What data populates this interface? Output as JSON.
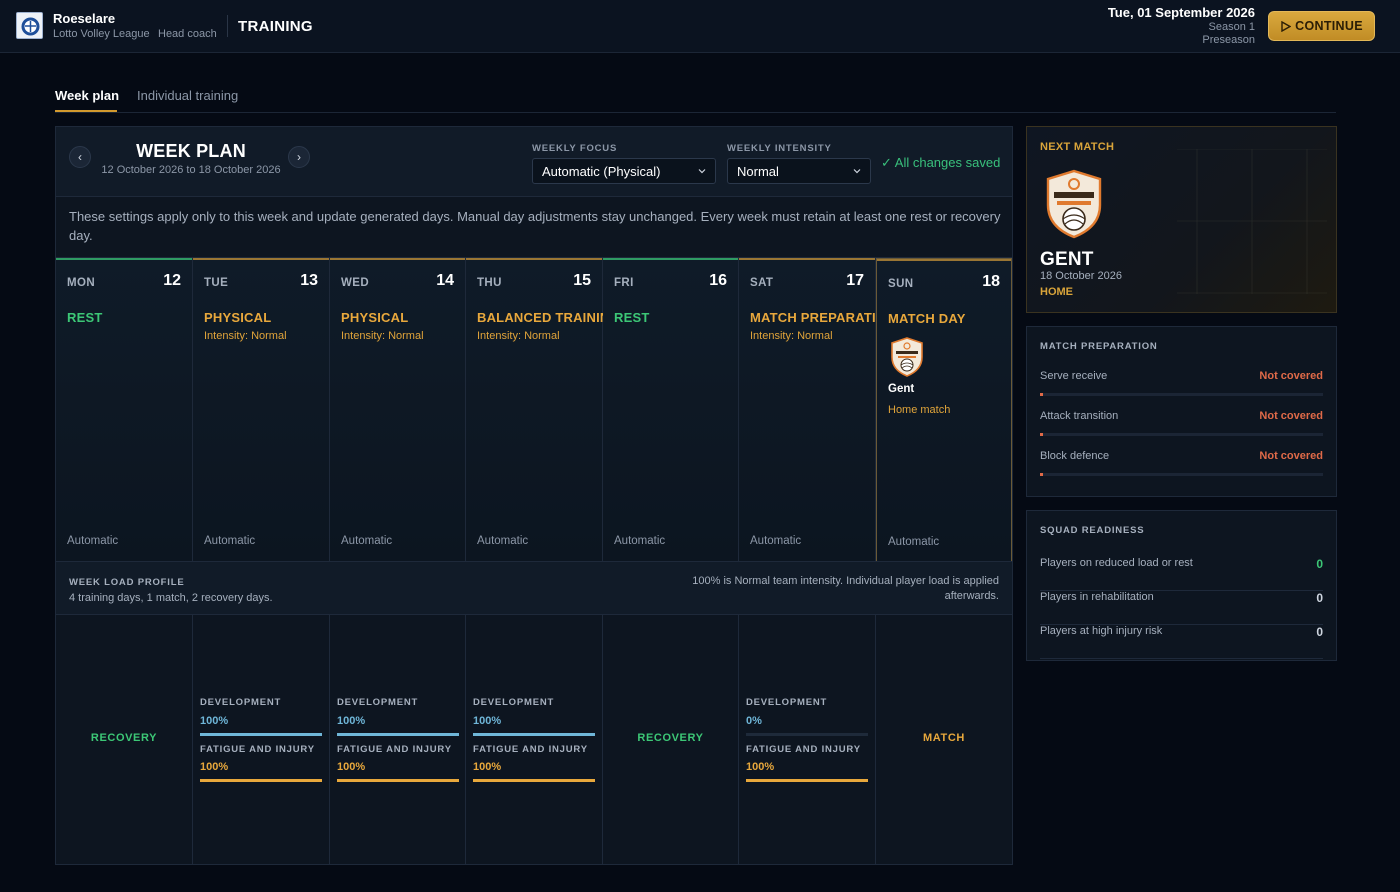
{
  "header": {
    "club_name": "Roeselare",
    "league": "Lotto Volley League",
    "role": "Head coach",
    "page_title": "TRAINING",
    "date": "Tue, 01 September 2026",
    "season": "Season 1",
    "phase": "Preseason",
    "continue_label": "CONTINUE"
  },
  "tabs": [
    {
      "label": "Week plan",
      "active": true
    },
    {
      "label": "Individual training",
      "active": false
    }
  ],
  "week_plan": {
    "title": "WEEK PLAN",
    "range": "12 October 2026 to 18 October 2026",
    "weekly_focus_label": "WEEKLY FOCUS",
    "weekly_focus_value": "Automatic (Physical)",
    "weekly_intensity_label": "WEEKLY INTENSITY",
    "weekly_intensity_value": "Normal",
    "saved_status": "✓ All changes saved",
    "info": "These settings apply only to this week and update generated days. Manual day adjustments stay unchanged. Every week must retain at least one rest or recovery day."
  },
  "days": [
    {
      "name": "MON",
      "num": "12",
      "type": "REST",
      "intensity": "",
      "mode": "Automatic",
      "color": "#3cc776",
      "top": "#2f9b63"
    },
    {
      "name": "TUE",
      "num": "13",
      "type": "PHYSICAL",
      "intensity": "Intensity: Normal",
      "mode": "Automatic",
      "color": "#e8a83c",
      "top": "#9a7634"
    },
    {
      "name": "WED",
      "num": "14",
      "type": "PHYSICAL",
      "intensity": "Intensity: Normal",
      "mode": "Automatic",
      "color": "#e8a83c",
      "top": "#9a7634"
    },
    {
      "name": "THU",
      "num": "15",
      "type": "BALANCED TRAINING",
      "intensity": "Intensity: Normal",
      "mode": "Automatic",
      "color": "#e8a83c",
      "top": "#9a7634"
    },
    {
      "name": "FRI",
      "num": "16",
      "type": "REST",
      "intensity": "",
      "mode": "Automatic",
      "color": "#3cc776",
      "top": "#2f9b63"
    },
    {
      "name": "SAT",
      "num": "17",
      "type": "MATCH PREPARATION",
      "intensity": "Intensity: Normal",
      "mode": "Automatic",
      "color": "#e8a83c",
      "top": "#9a7634"
    },
    {
      "name": "SUN",
      "num": "18",
      "type": "MATCH DAY",
      "intensity": "",
      "mode": "Automatic",
      "color": "#e8a83c",
      "top": "#9a7634",
      "opponent": "Gent",
      "opponent_sub": "Home match"
    }
  ],
  "load_profile": {
    "title": "WEEK LOAD PROFILE",
    "summary": "4 training days, 1 match, 2 recovery days.",
    "note": "100% is Normal team intensity. Individual player load is applied afterwards.",
    "dev_label": "DEVELOPMENT",
    "fat_label": "FATIGUE AND INJURY",
    "columns": [
      {
        "kind": "label",
        "text": "RECOVERY",
        "color": "#3cc776"
      },
      {
        "kind": "metrics",
        "dev": "100%",
        "dev_fill": 1.0,
        "fat": "100%",
        "fat_fill": 1.0
      },
      {
        "kind": "metrics",
        "dev": "100%",
        "dev_fill": 1.0,
        "fat": "100%",
        "fat_fill": 1.0
      },
      {
        "kind": "metrics",
        "dev": "100%",
        "dev_fill": 1.0,
        "fat": "100%",
        "fat_fill": 1.0
      },
      {
        "kind": "label",
        "text": "RECOVERY",
        "color": "#3cc776"
      },
      {
        "kind": "metrics",
        "dev": "0%",
        "dev_fill": 0.0,
        "fat": "100%",
        "fat_fill": 1.0
      },
      {
        "kind": "label",
        "text": "MATCH",
        "color": "#e8a83c"
      }
    ]
  },
  "next_match": {
    "label": "NEXT MATCH",
    "team": "GENT",
    "date": "18 October 2026",
    "venue": "HOME",
    "logo_text": "Volley Gent"
  },
  "match_preparation": {
    "title": "MATCH PREPARATION",
    "rows": [
      {
        "label": "Serve receive",
        "status": "Not covered",
        "fill": 0.01
      },
      {
        "label": "Attack transition",
        "status": "Not covered",
        "fill": 0.01
      },
      {
        "label": "Block defence",
        "status": "Not covered",
        "fill": 0.01
      }
    ]
  },
  "squad_readiness": {
    "title": "SQUAD READINESS",
    "rows": [
      {
        "label": "Players on reduced load or rest",
        "value": "0",
        "color": "#3cc776"
      },
      {
        "label": "Players in rehabilitation",
        "value": "0",
        "color": "#cfd6e0"
      },
      {
        "label": "Players at high injury risk",
        "value": "0",
        "color": "#cfd6e0"
      }
    ]
  },
  "colors": {
    "accent": "#d39a2e",
    "rest": "#3cc776",
    "training": "#e8a83c",
    "development": "#6fb6d8",
    "danger": "#e06a48"
  }
}
